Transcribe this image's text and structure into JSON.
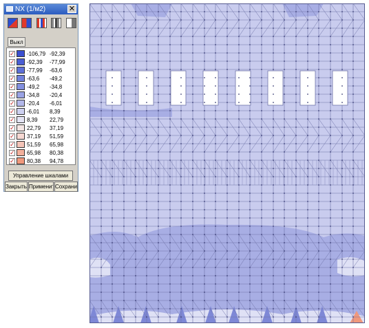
{
  "panel": {
    "title": "NX (1/м2)",
    "close_glyph": "✕",
    "mode_icons": [
      "fill-mode-icon",
      "fill-sign-icon",
      "stripes-color-icon",
      "stripes-gray-icon",
      "isolines-icon"
    ],
    "off_button": "Выкл",
    "check_glyph": "✓",
    "legend": [
      {
        "from": "-106,79",
        "to": "-92,39",
        "color": "#3a4fd0"
      },
      {
        "from": "-92,39",
        "to": "-77,99",
        "color": "#4b5fd4"
      },
      {
        "from": "-77,99",
        "to": "-63,6",
        "color": "#5e70d8"
      },
      {
        "from": "-63,6",
        "to": "-49,2",
        "color": "#7080dc"
      },
      {
        "from": "-49,2",
        "to": "-34,8",
        "color": "#8390e0"
      },
      {
        "from": "-34,8",
        "to": "-20,4",
        "color": "#9aa3e4"
      },
      {
        "from": "-20,4",
        "to": "-6,01",
        "color": "#b3b8ea"
      },
      {
        "from": "-6,01",
        "to": "8,39",
        "color": "#cdd0f0"
      },
      {
        "from": "8,39",
        "to": "22,79",
        "color": "#e4e4f4"
      },
      {
        "from": "22,79",
        "to": "37,19",
        "color": "#f4e6e4"
      },
      {
        "from": "37,19",
        "to": "51,59",
        "color": "#f6d8d2"
      },
      {
        "from": "51,59",
        "to": "65,98",
        "color": "#f4c4b8"
      },
      {
        "from": "65,98",
        "to": "80,38",
        "color": "#f2b09c"
      },
      {
        "from": "80,38",
        "to": "94,78",
        "color": "#f0987c"
      }
    ],
    "scale_button": "Управление шкалами",
    "close_button": "Закрыть",
    "apply_button": "Применить",
    "save_button": "Сохранить"
  },
  "viewport": {
    "base_color": "#c9ccee",
    "blue_zone_color": "#a8aee4",
    "dark_spot_color": "#7e88d6",
    "light_zone_color": "#dfe1f5",
    "hot_spot_color": "#f0987c",
    "mesh_color": "#6f73a8",
    "opening_count": 8
  }
}
